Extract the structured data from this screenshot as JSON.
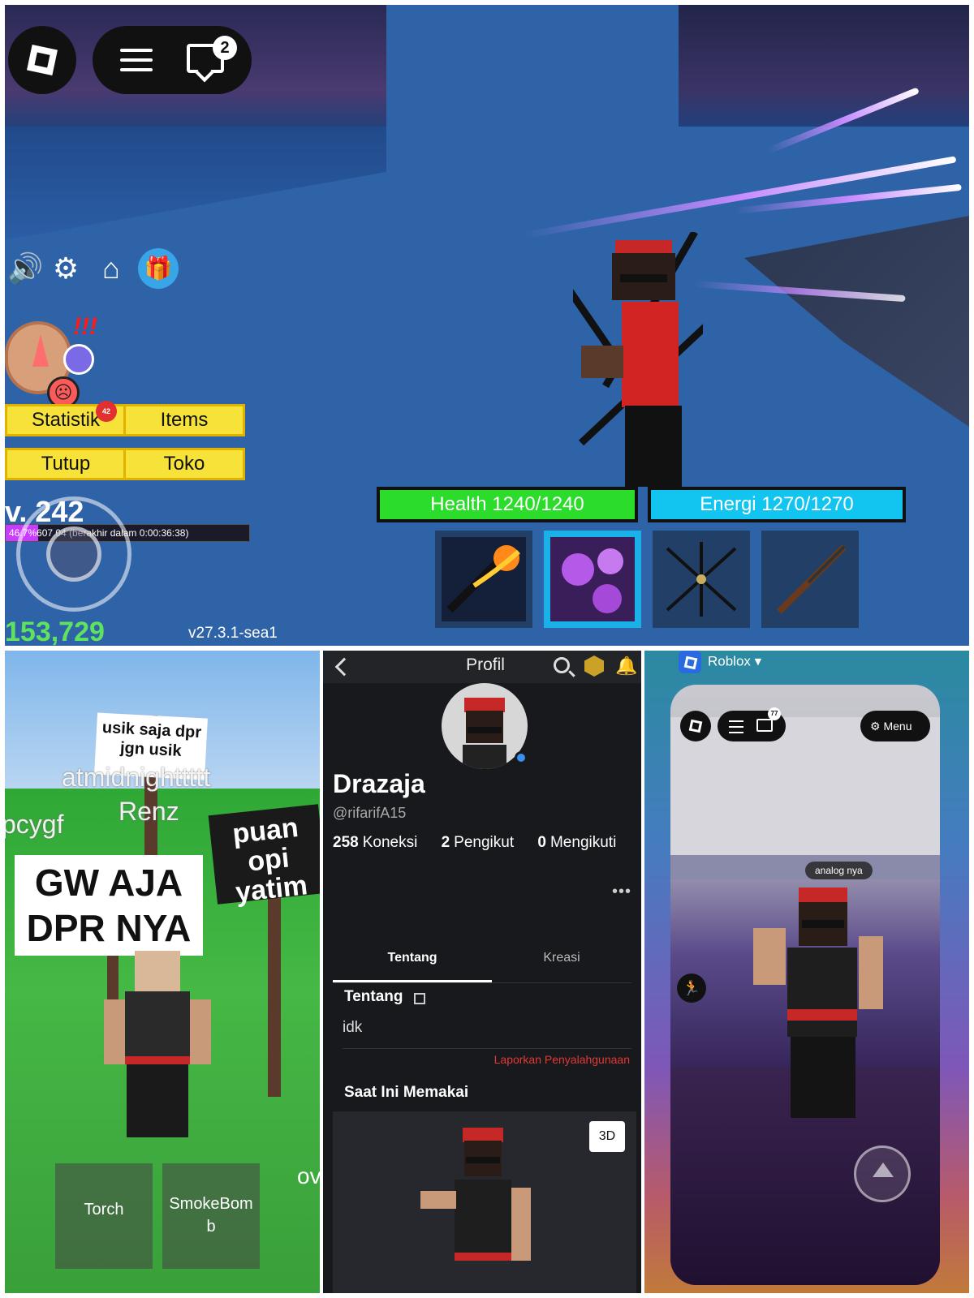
{
  "game_hud": {
    "chat_badge": "2",
    "stats_button": "Statistik",
    "stats_badge": "42",
    "items_button": "Items",
    "close_button": "Tutup",
    "shop_button": "Toko",
    "level": "v. 242",
    "timer_text": "46.7%607.04 (berakhir dalam 0:00:36:38)",
    "money": "153,729",
    "version": "v27.3.1-sea1",
    "health_label": "Health 1240/1240",
    "energy_label": "Energi 1270/1270",
    "alert_marks": "!!!",
    "icons": [
      "speaker-icon",
      "settings-warning-icon",
      "home-icon",
      "gift-icon"
    ],
    "hotbar": [
      "fire-fist-icon",
      "purple-saws-icon",
      "crossed-swords-icon",
      "rifle-icon"
    ],
    "colors": {
      "health": "#2bdc2b",
      "energy": "#12c4f0",
      "button": "#f7e23a"
    }
  },
  "game2": {
    "sign_top": "usik saja dpr jgn usik",
    "name_tag_1": "atmidnighttttt",
    "name_tag_2": "Renz",
    "name_tag_3": "pcygf",
    "sign_main_line1": "GW AJA",
    "sign_main_line2": "DPR NYA",
    "sign_right": "puan opi yatim",
    "tool_1": "Torch",
    "tool_2": "SmokeBom b",
    "edge_text": "ov"
  },
  "profile": {
    "header_title": "Profil",
    "display_name": "Drazaja",
    "username": "@rifarifA15",
    "stats": [
      {
        "count": "258",
        "label": "Koneksi"
      },
      {
        "count": "2",
        "label": "Pengikut"
      },
      {
        "count": "0",
        "label": "Mengikuti"
      }
    ],
    "more": "•••",
    "tabs": [
      "Tentang",
      "Kreasi"
    ],
    "about_heading": "Tentang",
    "about_text": "idk",
    "report_link": "Laporkan Penyalahgunaan",
    "wearing_heading": "Saat Ini Memakai",
    "button_3d": "3D"
  },
  "app_switch": {
    "app_name": "Roblox ▾",
    "chat_badge": "77",
    "menu_label": "Menu",
    "speech_bubble": "analog nya"
  }
}
